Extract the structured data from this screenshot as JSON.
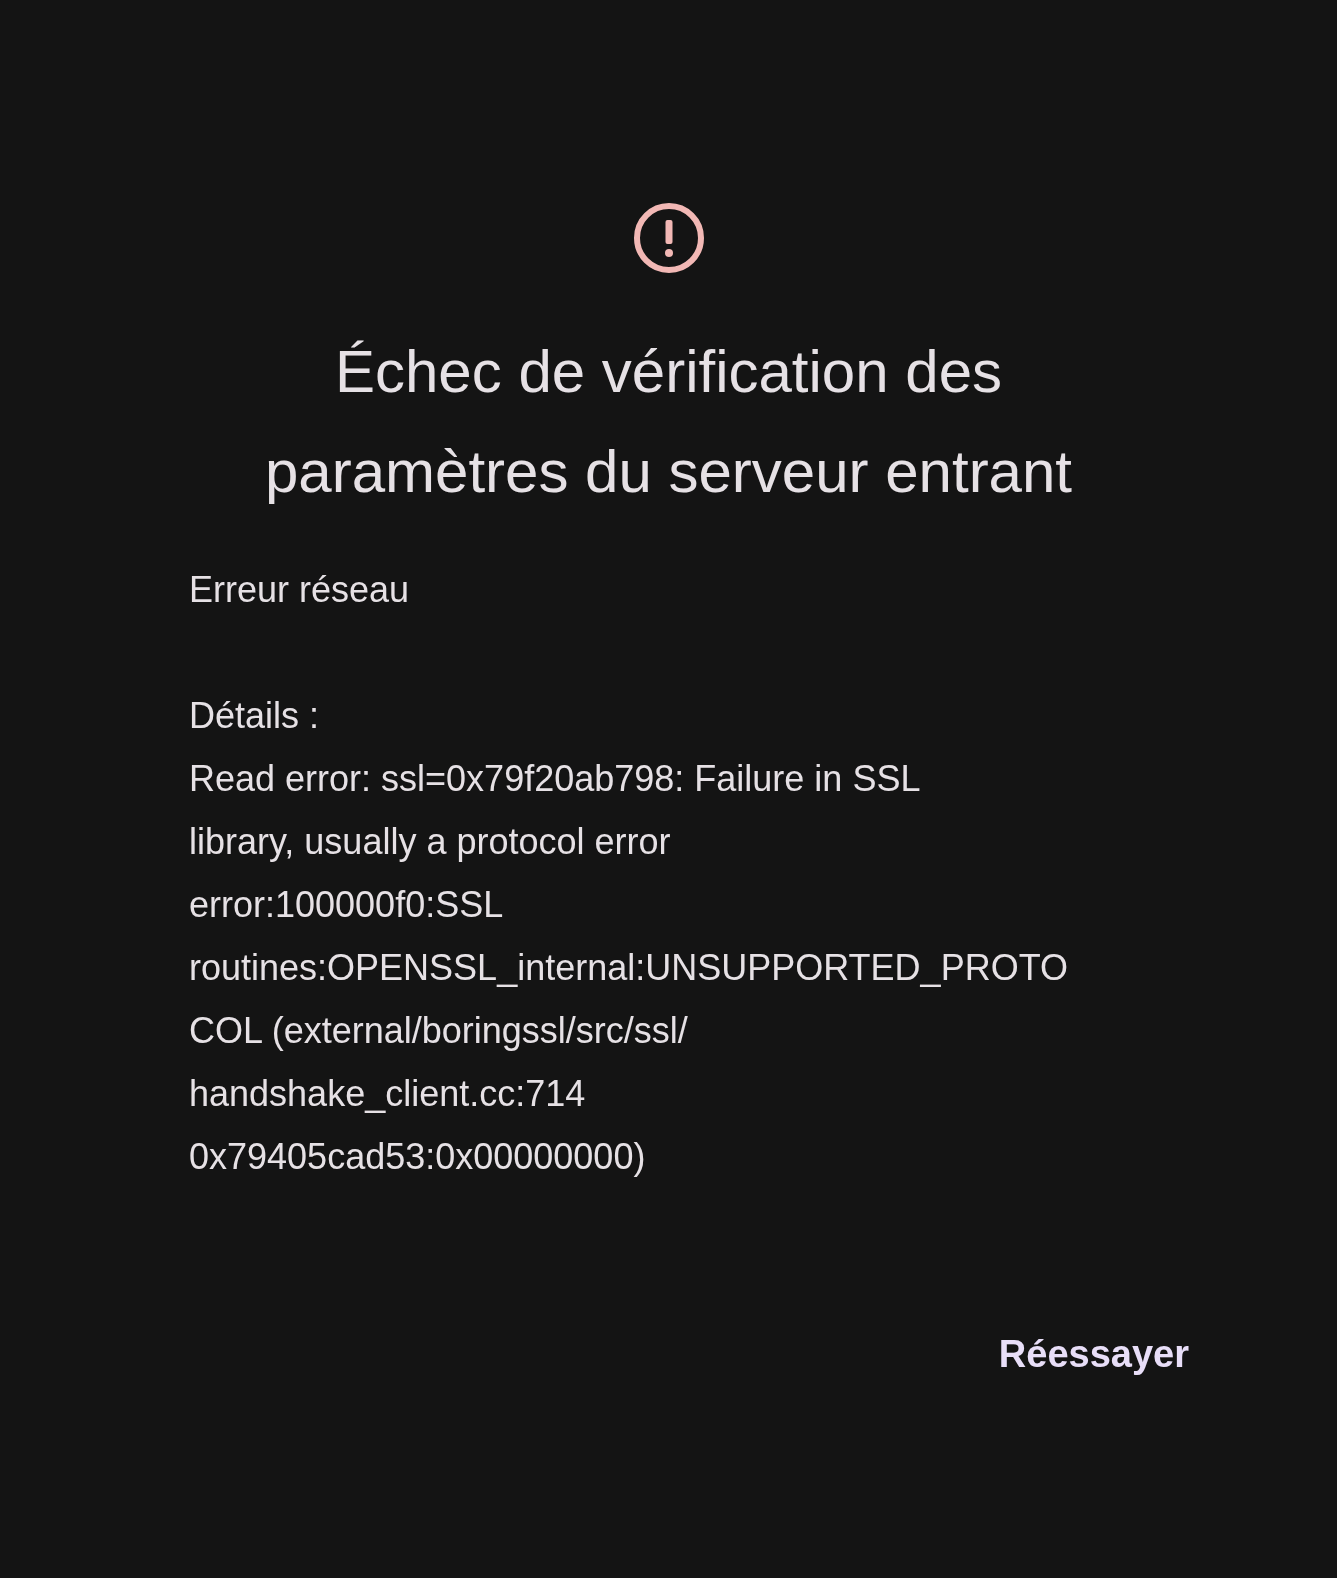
{
  "title_lines": [
    "Échec de vérification des",
    "paramètres du serveur entrant"
  ],
  "error": "Erreur réseau",
  "details_label": "Détails :",
  "details_lines": [
    "Read error: ssl=0x79f20ab798: Failure in SSL",
    "library, usually a protocol error",
    "error:100000f0:SSL",
    "routines:OPENSSL_internal:UNSUPPORTED_PROTO",
    "COL (external/boringssl/src/ssl/",
    "handshake_client.cc:714",
    "0x79405cad53:0x00000000)"
  ],
  "retry_button": "Réessayer"
}
